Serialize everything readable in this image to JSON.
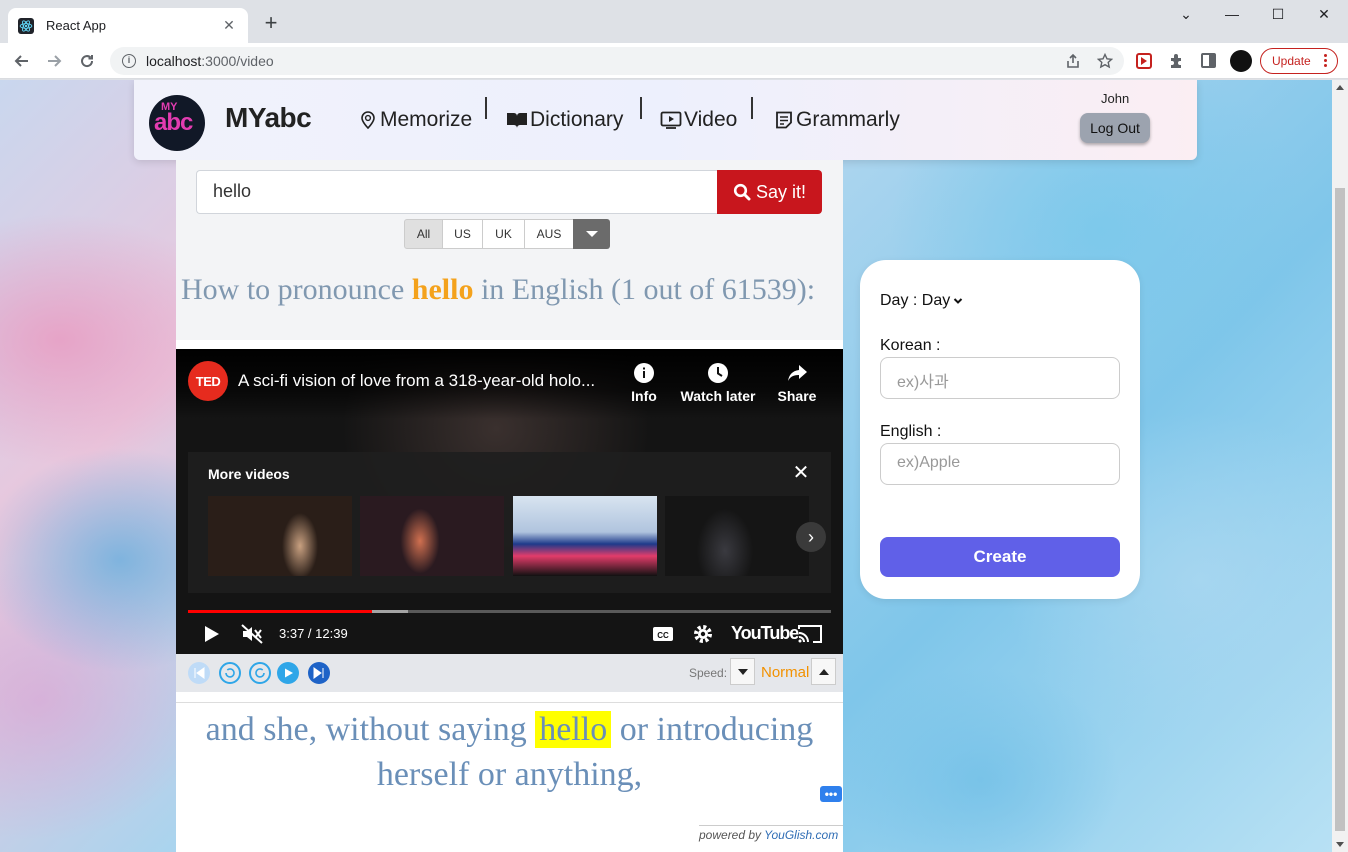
{
  "browser": {
    "tab_title": "React App",
    "url_host": "localhost",
    "url_path": ":3000/video",
    "update_label": "Update"
  },
  "header": {
    "logo_top": "MY",
    "logo_main": "abc",
    "brand": "MYabc",
    "nav": [
      "Memorize",
      "Dictionary",
      "Video",
      "Grammarly"
    ],
    "user": "John",
    "logout": "Log Out"
  },
  "youglish": {
    "search_value": "hello",
    "say_label": "Say it!",
    "accents": [
      "All",
      "US",
      "UK",
      "AUS"
    ],
    "title_prefix": "How to pronounce ",
    "keyword": "hello",
    "title_suffix": " in English (1 out of 61539):",
    "video_title": "A sci-fi vision of love from a 318-year-old holo...",
    "channel_logo": "TED",
    "actions": [
      "Info",
      "Watch later",
      "Share"
    ],
    "more_videos": "More videos",
    "time": "3:37 / 12:39",
    "progress": 0.2856,
    "yt_logo": "YouTube",
    "speed_label": "Speed:",
    "speed_value": "Normal",
    "caption_before": "and she, without saying ",
    "caption_keyword": "hello",
    "caption_after": " or introducing herself or anything,",
    "powered_prefix": "powered by ",
    "powered_brand": "YouGlish.com"
  },
  "form": {
    "day_label": "Day : Day",
    "korean_label": "Korean :",
    "korean_placeholder": "ex)사과",
    "english_label": "English :",
    "english_placeholder": "ex)Apple",
    "create": "Create"
  },
  "colors": {
    "accent_red": "#c8161d",
    "keyword_orange": "#f4a21c",
    "create_purple": "#6060e8",
    "highlight_yellow": "#ffff00"
  }
}
